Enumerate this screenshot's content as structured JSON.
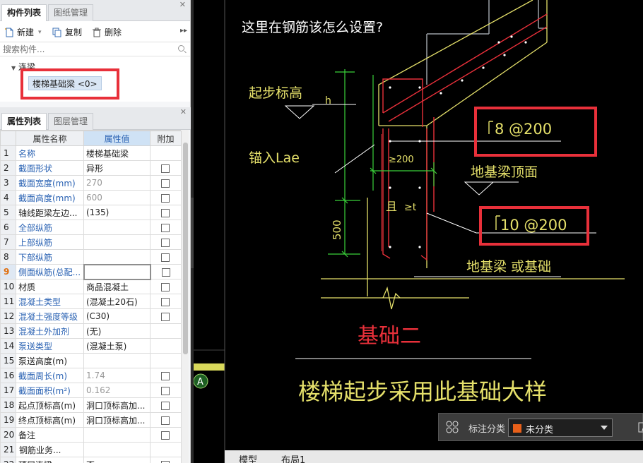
{
  "left_top": {
    "tabs": [
      "构件列表",
      "图纸管理"
    ],
    "toolbar": {
      "new": "新建",
      "copy": "复制",
      "delete": "删除"
    },
    "search_placeholder": "搜索构件...",
    "tree_group": "连梁",
    "tree_item": "楼梯基础梁 <0>"
  },
  "left_bottom": {
    "tabs": [
      "属性列表",
      "图层管理"
    ],
    "headers": {
      "name": "属性名称",
      "value": "属性值",
      "extra": "附加"
    },
    "rows": [
      {
        "n": "1",
        "name": "名称",
        "value": "楼梯基础梁",
        "cb": false
      },
      {
        "n": "2",
        "name": "截面形状",
        "value": "异形",
        "cb": true
      },
      {
        "n": "3",
        "name": "截面宽度(mm)",
        "value": "270",
        "cb": true
      },
      {
        "n": "4",
        "name": "截面高度(mm)",
        "value": "600",
        "cb": true
      },
      {
        "n": "5",
        "name": "轴线距梁左边...",
        "value": "(135)",
        "cb": true
      },
      {
        "n": "6",
        "name": "全部纵筋",
        "value": "",
        "cb": true
      },
      {
        "n": "7",
        "name": "上部纵筋",
        "value": "",
        "cb": true
      },
      {
        "n": "8",
        "name": "下部纵筋",
        "value": "",
        "cb": true
      },
      {
        "n": "9",
        "name": "侧面纵筋(总配...",
        "value": "",
        "cb": true
      },
      {
        "n": "10",
        "name": "材质",
        "value": "商品混凝土",
        "cb": true
      },
      {
        "n": "11",
        "name": "混凝土类型",
        "value": "(混凝土20石)",
        "cb": true
      },
      {
        "n": "12",
        "name": "混凝土强度等级",
        "value": "(C30)",
        "cb": true
      },
      {
        "n": "13",
        "name": "混凝土外加剂",
        "value": "(无)",
        "cb": false
      },
      {
        "n": "14",
        "name": "泵送类型",
        "value": "(混凝土泵)",
        "cb": false
      },
      {
        "n": "15",
        "name": "泵送高度(m)",
        "value": "",
        "cb": false
      },
      {
        "n": "16",
        "name": "截面周长(m)",
        "value": "1.74",
        "cb": true
      },
      {
        "n": "17",
        "name": "截面面积(m²)",
        "value": "0.162",
        "cb": true
      },
      {
        "n": "18",
        "name": "起点顶标高(m)",
        "value": "洞口顶标高加...",
        "cb": true
      },
      {
        "n": "19",
        "name": "终点顶标高(m)",
        "value": "洞口顶标高加...",
        "cb": true
      },
      {
        "n": "20",
        "name": "备注",
        "value": "",
        "cb": true
      },
      {
        "n": "21",
        "name": "钢筋业务...",
        "value": "",
        "cb": false
      },
      {
        "n": "22",
        "name": "     顶层连梁",
        "value": "否",
        "cb": true
      }
    ]
  },
  "cad": {
    "question": "这里在钢筋该怎么设置?",
    "labels": {
      "start_elev": "起步标高",
      "h": "h",
      "anchor": "锚入Lae",
      "ge200": "≥200",
      "qie": "且",
      "ge_t": "≥t",
      "dim500": "500",
      "rebar1": "8 @200",
      "rebar2": "10 @200",
      "ground_top": "地基梁顶面",
      "ground_beam": "地基梁    或基础",
      "foundation": "基础二",
      "caption": "楼梯起步采用此基础大样",
      "axis": "A"
    },
    "status": {
      "label": "标注分类",
      "value": "未分类"
    },
    "layout_tabs": [
      "模型",
      "布局1"
    ]
  }
}
